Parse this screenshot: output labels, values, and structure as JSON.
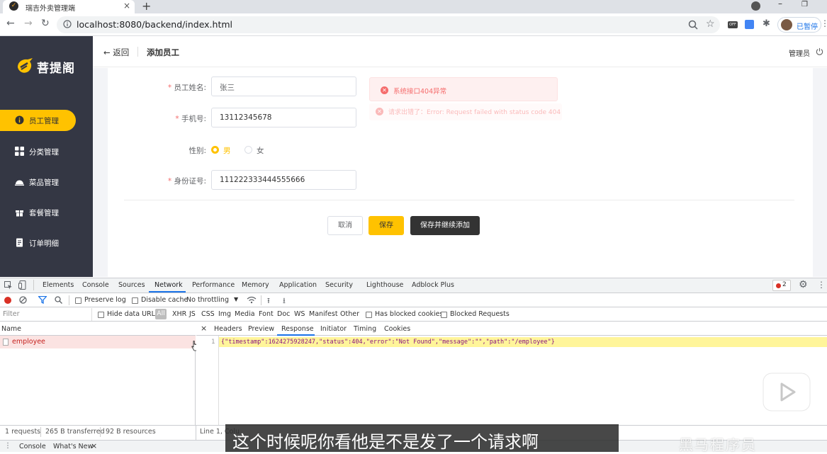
{
  "browser": {
    "tab_title": "瑞吉外卖管理端",
    "tab_favicon": "pin-logo-icon",
    "url": "localhost:8080/backend/index.html",
    "profile_status": "已暂停"
  },
  "sidebar": {
    "logo_text": "菩提阁",
    "items": [
      {
        "label": "员工管理",
        "icon": "person-icon",
        "active": true
      },
      {
        "label": "分类管理",
        "icon": "grid-icon",
        "active": false
      },
      {
        "label": "菜品管理",
        "icon": "dish-icon",
        "active": false
      },
      {
        "label": "套餐管理",
        "icon": "gift-icon",
        "active": false
      },
      {
        "label": "订单明细",
        "icon": "document-icon",
        "active": false
      }
    ]
  },
  "header": {
    "back_label": "返回",
    "title": "添加员工",
    "user": "管理员"
  },
  "form": {
    "name_label": "员工姓名:",
    "name_value": "张三",
    "phone_label": "手机号:",
    "phone_value": "13112345678",
    "gender_label": "性别:",
    "gender_male": "男",
    "gender_female": "女",
    "gender_selected": "男",
    "idnum_label": "身份证号:",
    "idnum_value": "111222333444555666",
    "cancel": "取消",
    "save": "保存",
    "save_continue": "保存并继续添加"
  },
  "toasts": [
    {
      "text": "系统接口404异常"
    },
    {
      "text": "请求出错了：Error: Request failed with status code 404"
    }
  ],
  "devtools": {
    "tabs": [
      "Elements",
      "Console",
      "Sources",
      "Network",
      "Performance",
      "Memory",
      "Application",
      "Security",
      "Lighthouse",
      "Adblock Plus"
    ],
    "active_tab": "Network",
    "error_count": "2",
    "preserve_log": "Preserve log",
    "disable_cache": "Disable cache",
    "throttling": "No throttling",
    "filter_placeholder": "Filter",
    "hide_data_urls": "Hide data URLs",
    "type_filters": [
      "All",
      "XHR",
      "JS",
      "CSS",
      "Img",
      "Media",
      "Font",
      "Doc",
      "WS",
      "Manifest",
      "Other"
    ],
    "has_blocked_cookies": "Has blocked cookies",
    "blocked_requests": "Blocked Requests",
    "name_header": "Name",
    "requests": [
      "employee"
    ],
    "detail_tabs": [
      "Headers",
      "Preview",
      "Response",
      "Initiator",
      "Timing",
      "Cookies"
    ],
    "active_detail_tab": "Response",
    "line_number": "1",
    "response_text": "{\"timestamp\":1624275928247,\"status\":404,\"error\":\"Not Found\",\"message\":\"\",\"path\":\"/employee\"}",
    "status": {
      "requests": "1 requests",
      "transferred": "265 B transferred",
      "resources": "92 B resources",
      "cursor_pos": "Line 1, Colu"
    },
    "drawer_tabs": [
      "Console",
      "What's New"
    ]
  },
  "overlay": {
    "subtitle": "这个时候呢你看他是不是发了一个请求啊",
    "watermark": "黑马程序员"
  }
}
